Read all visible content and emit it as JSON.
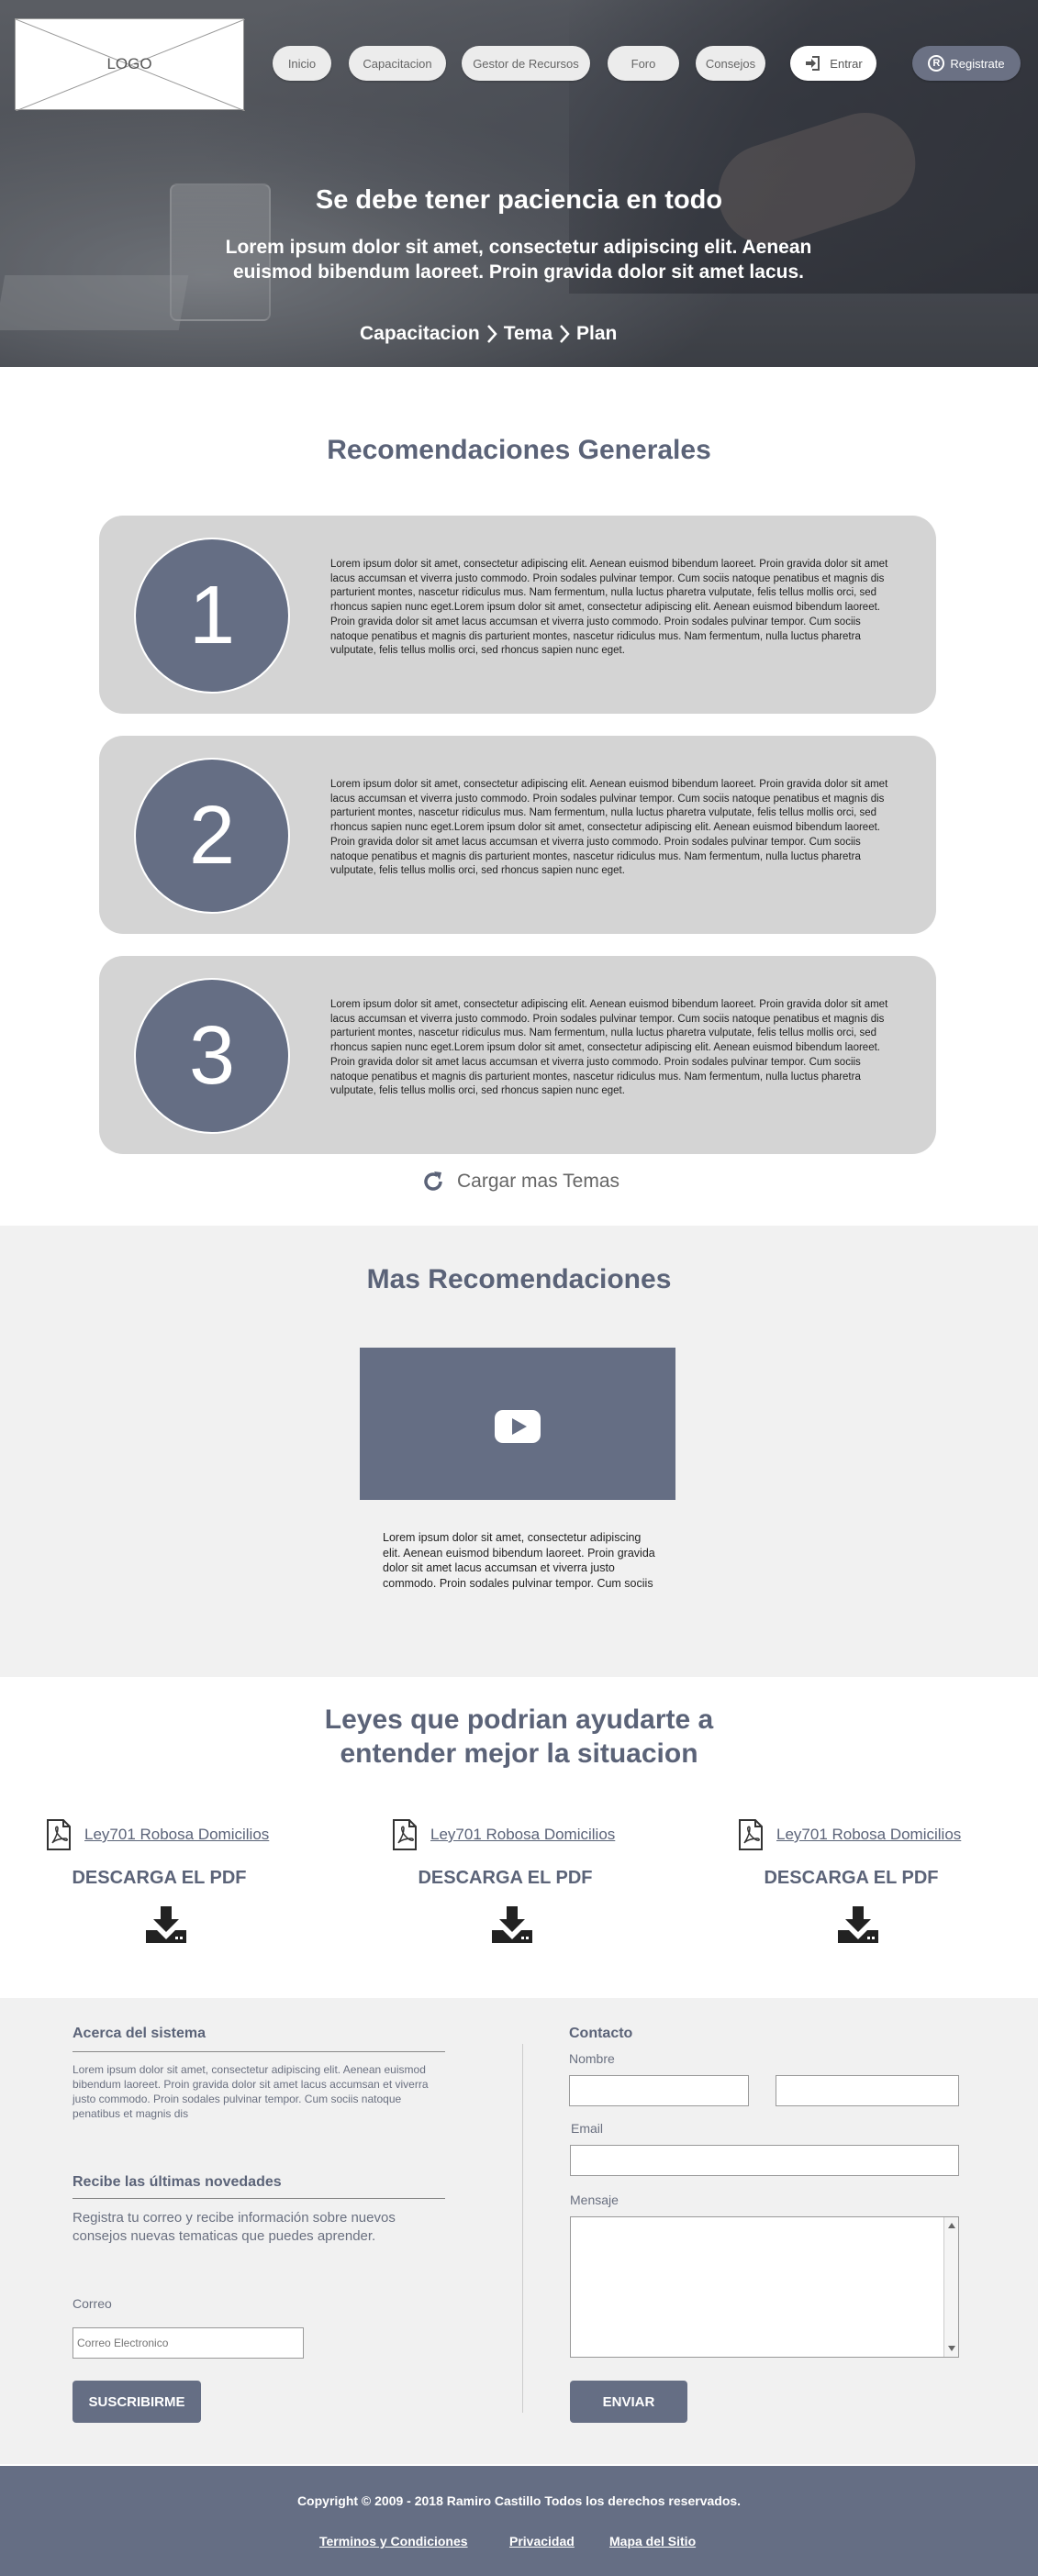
{
  "header": {
    "logo_text": "LOGO",
    "nav": [
      "Inicio",
      "Capacitacion",
      "Gestor de Recursos",
      "Foro",
      "Consejos"
    ],
    "login_label": "Entrar",
    "register_label": "Registrate",
    "register_glyph": "R"
  },
  "hero": {
    "title": "Se debe tener paciencia en todo",
    "subtitle": "Lorem ipsum dolor sit amet, consectetur adipiscing elit. Aenean euismod bibendum laoreet. Proin gravida dolor sit amet lacus.",
    "breadcrumb": [
      "Capacitacion",
      "Tema",
      "Plan"
    ]
  },
  "recomendaciones": {
    "title": "Recomendaciones Generales",
    "items": [
      {
        "number": "1",
        "text": "Lorem ipsum dolor sit amet, consectetur adipiscing elit. Aenean euismod bibendum laoreet. Proin gravida dolor sit amet lacus accumsan et viverra justo commodo. Proin sodales pulvinar tempor. Cum sociis natoque penatibus et magnis dis parturient montes, nascetur ridiculus mus. Nam fermentum, nulla luctus pharetra vulputate, felis tellus mollis orci, sed rhoncus sapien nunc eget.Lorem ipsum dolor sit amet, consectetur adipiscing elit. Aenean euismod bibendum laoreet. Proin gravida dolor sit amet lacus accumsan et viverra justo commodo. Proin sodales pulvinar tempor. Cum sociis natoque penatibus et magnis dis parturient montes, nascetur ridiculus mus. Nam fermentum, nulla luctus pharetra vulputate, felis tellus mollis orci, sed rhoncus sapien nunc eget."
      },
      {
        "number": "2",
        "text": "Lorem ipsum dolor sit amet, consectetur adipiscing elit. Aenean euismod bibendum laoreet. Proin gravida dolor sit amet lacus accumsan et viverra justo commodo. Proin sodales pulvinar tempor. Cum sociis natoque penatibus et magnis dis parturient montes, nascetur ridiculus mus. Nam fermentum, nulla luctus pharetra vulputate, felis tellus mollis orci, sed rhoncus sapien nunc eget.Lorem ipsum dolor sit amet, consectetur adipiscing elit. Aenean euismod bibendum laoreet. Proin gravida dolor sit amet lacus accumsan et viverra justo commodo. Proin sodales pulvinar tempor. Cum sociis natoque penatibus et magnis dis parturient montes, nascetur ridiculus mus. Nam fermentum, nulla luctus pharetra vulputate, felis tellus mollis orci, sed rhoncus sapien nunc eget."
      },
      {
        "number": "3",
        "text": "Lorem ipsum dolor sit amet, consectetur adipiscing elit. Aenean euismod bibendum laoreet. Proin gravida dolor sit amet lacus accumsan et viverra justo commodo. Proin sodales pulvinar tempor. Cum sociis natoque penatibus et magnis dis parturient montes, nascetur ridiculus mus. Nam fermentum, nulla luctus pharetra vulputate, felis tellus mollis orci, sed rhoncus sapien nunc eget.Lorem ipsum dolor sit amet, consectetur adipiscing elit. Aenean euismod bibendum laoreet. Proin gravida dolor sit amet lacus accumsan et viverra justo commodo. Proin sodales pulvinar tempor. Cum sociis natoque penatibus et magnis dis parturient montes, nascetur ridiculus mus. Nam fermentum, nulla luctus pharetra vulputate, felis tellus mollis orci, sed rhoncus sapien nunc eget."
      }
    ],
    "load_more": "Cargar mas Temas"
  },
  "mas": {
    "title": "Mas Recomendaciones",
    "video_text": "Lorem ipsum dolor sit amet, consectetur adipiscing elit. Aenean euismod bibendum laoreet. Proin gravida dolor sit amet lacus accumsan et viverra justo commodo. Proin sodales pulvinar tempor. Cum sociis"
  },
  "leyes": {
    "title_line1": "Leyes que podrian ayudarte a",
    "title_line2": "entender mejor la situacion",
    "items": [
      {
        "link": "Ley701 Robosa Domicilios",
        "download": "DESCARGA EL PDF"
      },
      {
        "link": "Ley701 Robosa Domicilios",
        "download": "DESCARGA EL PDF"
      },
      {
        "link": "Ley701 Robosa Domicilios",
        "download": "DESCARGA EL PDF"
      }
    ]
  },
  "footer": {
    "about_title": "Acerca del sistema",
    "about_text": "Lorem ipsum dolor sit amet, consectetur adipiscing elit. Aenean euismod bibendum laoreet. Proin gravida dolor sit amet lacus accumsan et viverra justo commodo. Proin sodales pulvinar tempor. Cum sociis natoque penatibus et magnis dis",
    "news_title": "Recibe las últimas novedades",
    "news_text": "Registra tu correo y recibe información sobre nuevos consejos nuevas tematicas que puedes aprender.",
    "email_label": "Correo",
    "email_placeholder": "Correo Electronico",
    "subscribe_label": "SUSCRIBIRME",
    "contact_title": "Contacto",
    "name_label": "Nombre",
    "mail_label": "Email",
    "message_label": "Mensaje",
    "send_label": "ENVIAR",
    "copyright": "Copyright © 2009 - 2018 Ramiro Castillo Todos los derechos reservados.",
    "links": [
      "Terminos y  Condiciones",
      "Privacidad",
      "Mapa del Sitio"
    ]
  },
  "colors": {
    "accent": "#656e84",
    "title": "#5b6378",
    "card": "#d4d4d4",
    "section_gray": "#f1f1f1"
  }
}
